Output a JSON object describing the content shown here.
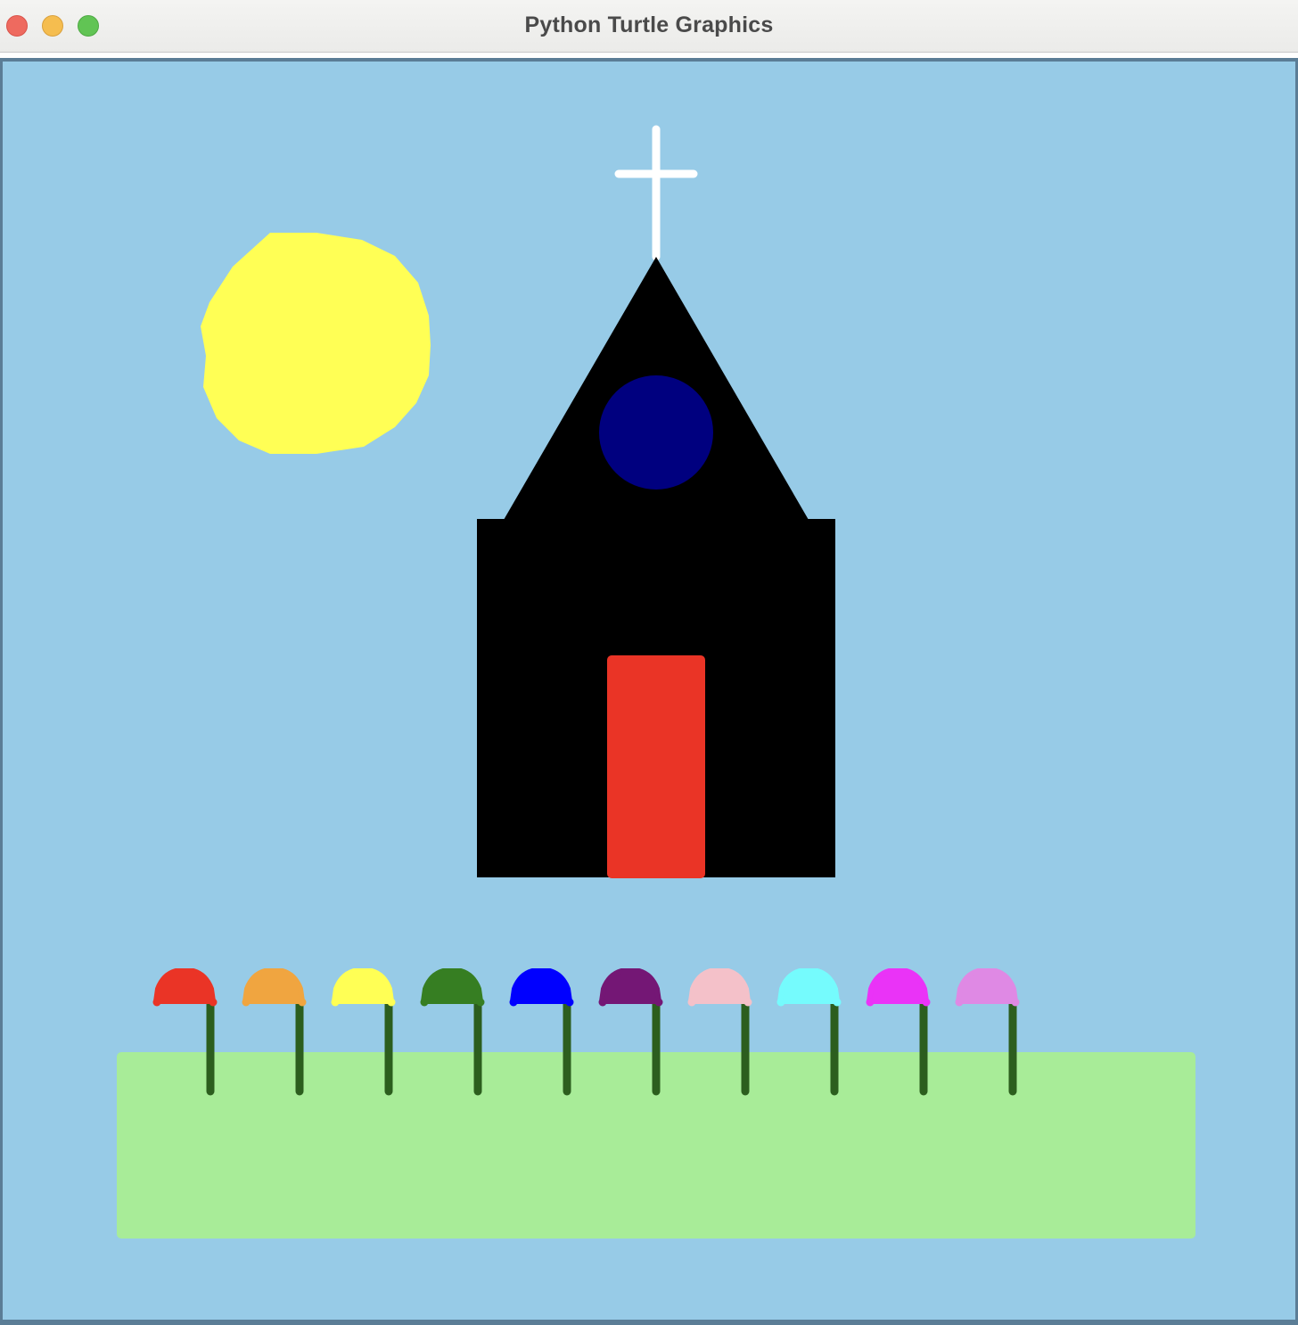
{
  "window": {
    "title": "Python Turtle Graphics",
    "controls": [
      "close-icon",
      "minimize-icon",
      "maximize-icon"
    ]
  },
  "scene": {
    "background_color": "#97cbe7",
    "sun_color": "#ffff55",
    "church_color": "#000000",
    "rose_window_color": "#00007f",
    "door_color": "#ea3426",
    "cross_color": "#ffffff",
    "grass_color": "#a8ec98",
    "stem_color": "#2c5e1e",
    "flower_colors": [
      "#ea3426",
      "#f0a540",
      "#ffff55",
      "#367e22",
      "#0000ff",
      "#741775",
      "#f4c1c9",
      "#75fbfd",
      "#ea33f7",
      "#df89e4"
    ]
  }
}
